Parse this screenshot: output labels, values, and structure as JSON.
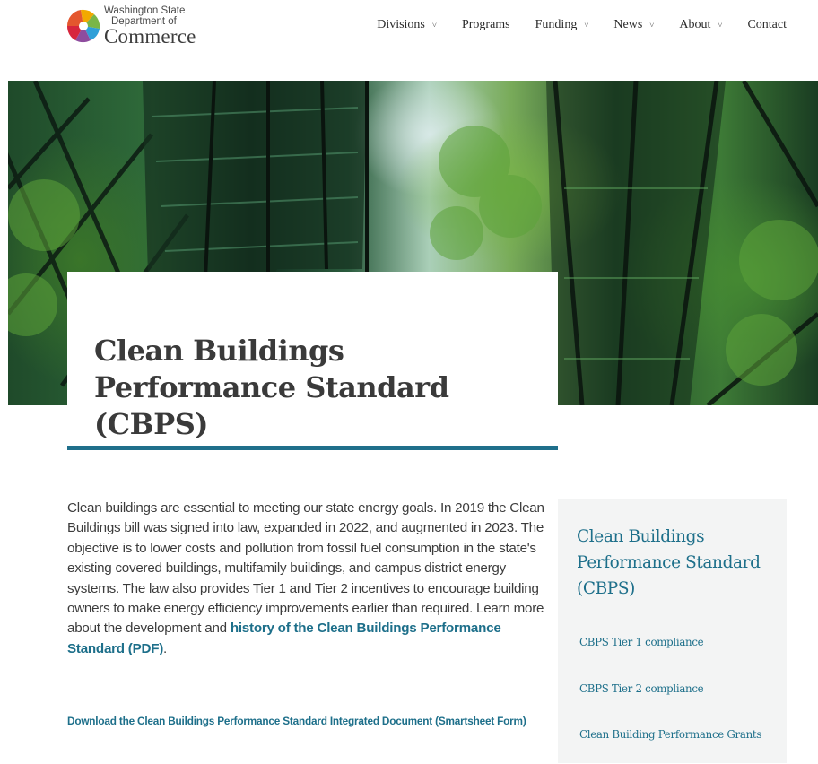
{
  "header": {
    "logo": {
      "line1": "Washington State",
      "line2": "Department of",
      "line3": "Commerce",
      "colors": [
        "#e4572e",
        "#f2a900",
        "#7ab648",
        "#2f9fd8",
        "#8e4c9e",
        "#d7263d"
      ]
    },
    "nav": [
      {
        "label": "Divisions",
        "has_dropdown": true
      },
      {
        "label": "Programs",
        "has_dropdown": false
      },
      {
        "label": "Funding",
        "has_dropdown": true
      },
      {
        "label": "News",
        "has_dropdown": true
      },
      {
        "label": "About",
        "has_dropdown": true
      },
      {
        "label": "Contact",
        "has_dropdown": false
      }
    ],
    "chevron_glyph": "˅"
  },
  "hero": {
    "title": "Clean Buildings Performance Standard (CBPS)"
  },
  "main": {
    "intro_text": "Clean buildings are essential to meeting our state energy goals. In 2019 the Clean Buildings bill was signed into law, expanded in 2022, and augmented in 2023. The objective is to lower costs and pollution from fossil fuel consumption in the state's existing covered buildings, multifamily buildings, and campus district energy systems. The law also provides Tier 1 and Tier 2 incentives to encourage building owners to make energy efficiency improvements earlier than required. Learn more about the development and ",
    "history_link": "history of the Clean Buildings Performance Standard (PDF)",
    "intro_end": ".",
    "download_link": "Download the Clean Buildings Performance Standard Integrated Document (Smartsheet Form)"
  },
  "sidebar": {
    "title": "Clean Buildings Performance Standard (CBPS)",
    "links": [
      "CBPS Tier 1 compliance",
      "CBPS Tier 2 compliance",
      "Clean Building Performance Grants"
    ]
  },
  "colors": {
    "accent": "#1d6f8a",
    "rule": "#1f6f8b",
    "sidebar_bg": "#f3f4f4",
    "heading": "#3a3a3a"
  }
}
